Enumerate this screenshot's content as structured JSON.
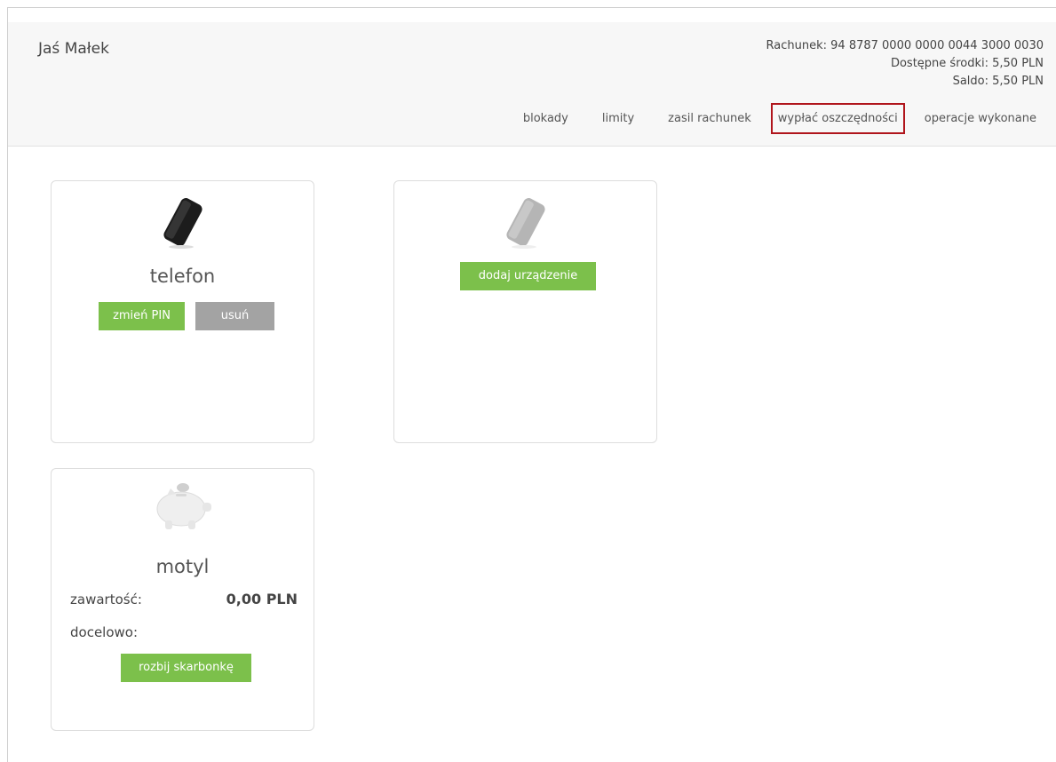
{
  "header": {
    "user_name": "Jaś Małek",
    "account": "Rachunek: 94 8787 0000 0000 0044 3000 0030",
    "available_funds": "Dostępne środki: 5,50 PLN",
    "balance": "Saldo: 5,50 PLN"
  },
  "nav": {
    "items": [
      "blokady",
      "limity",
      "zasil rachunek",
      "wypłać oszczędności",
      "operacje wykonane"
    ],
    "highlighted_index": 3,
    "highlight_color": "#b0151c"
  },
  "devices": [
    {
      "name": "telefon",
      "icon": "smartphone-icon",
      "buttons": [
        "zmień PIN",
        "usuń"
      ]
    },
    {
      "icon": "smartphone-placeholder-icon",
      "buttons": [
        "dodaj urządzenie"
      ]
    }
  ],
  "piggy": {
    "name": "motyl",
    "icon": "piggy-bank-icon",
    "content_label": "zawartość:",
    "content_value": "0,00 PLN",
    "target_label": "docelowo:",
    "button": "rozbij skarbonkę"
  },
  "colors": {
    "green_button": "#7cc04b",
    "gray_button": "#a3a3a3"
  }
}
